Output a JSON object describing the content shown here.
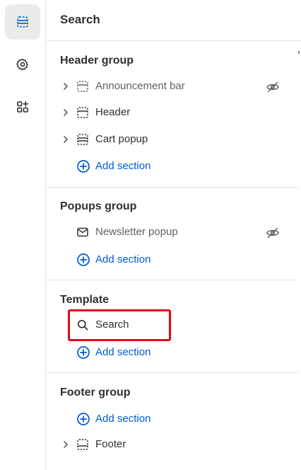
{
  "rail": {
    "items": [
      {
        "icon": "sections-icon",
        "active": true
      },
      {
        "icon": "gear-icon",
        "active": false
      },
      {
        "icon": "apps-icon",
        "active": false
      }
    ]
  },
  "panel": {
    "title": "Search",
    "header_group": {
      "title": "Header group",
      "items": [
        {
          "label": "Announcement bar",
          "hidden": true
        },
        {
          "label": "Header",
          "hidden": false
        },
        {
          "label": "Cart popup",
          "hidden": false
        }
      ],
      "add_label": "Add section"
    },
    "popups_group": {
      "title": "Popups group",
      "items": [
        {
          "label": "Newsletter popup",
          "hidden": true
        }
      ],
      "add_label": "Add section"
    },
    "template": {
      "title": "Template",
      "items": [
        {
          "label": "Search"
        }
      ],
      "add_label": "Add section"
    },
    "footer_group": {
      "title": "Footer group",
      "add_label": "Add section",
      "items": [
        {
          "label": "Footer"
        }
      ]
    }
  },
  "colors": {
    "accent": "#005bd3",
    "highlight": "#e4001b",
    "text": "#303030",
    "muted_text": "#616161"
  }
}
